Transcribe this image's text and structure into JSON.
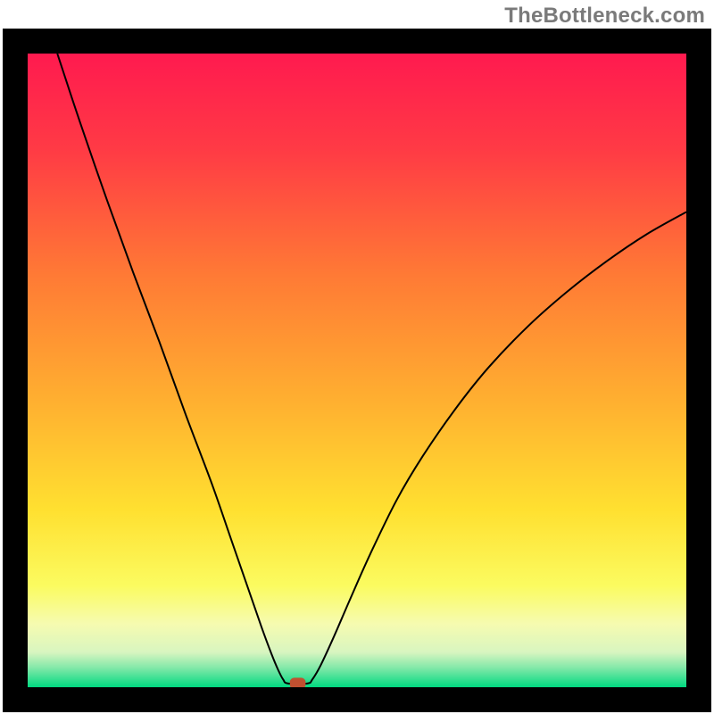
{
  "watermark": "TheBottleneck.com",
  "chart_data": {
    "type": "line",
    "title": "",
    "xlabel": "",
    "ylabel": "",
    "xlim": [
      0,
      100
    ],
    "ylim": [
      0,
      100
    ],
    "gradient_stops": [
      {
        "offset": 0.0,
        "color": "#ff1a4f"
      },
      {
        "offset": 0.15,
        "color": "#ff3a45"
      },
      {
        "offset": 0.35,
        "color": "#ff7a35"
      },
      {
        "offset": 0.55,
        "color": "#ffb030"
      },
      {
        "offset": 0.72,
        "color": "#ffe030"
      },
      {
        "offset": 0.84,
        "color": "#fbfb60"
      },
      {
        "offset": 0.9,
        "color": "#f6fbb0"
      },
      {
        "offset": 0.945,
        "color": "#d8f5c0"
      },
      {
        "offset": 0.97,
        "color": "#80e8a8"
      },
      {
        "offset": 1.0,
        "color": "#00d980"
      }
    ],
    "series": [
      {
        "name": "bottleneck-curve",
        "color": "#000000",
        "stroke_width": 2,
        "x": [
          4.5,
          8,
          12,
          16,
          20,
          24,
          28,
          31,
          33.5,
          35.5,
          37,
          38,
          38.8,
          39.5,
          42.5,
          43.2,
          44.5,
          46.5,
          49,
          52,
          56,
          60,
          65,
          70,
          76,
          82,
          88,
          94,
          100
        ],
        "y": [
          100,
          89,
          77,
          65.5,
          54.5,
          43,
          32,
          23,
          15.5,
          9.5,
          5.3,
          2.8,
          1.2,
          0.6,
          0.6,
          1.2,
          3.5,
          8,
          14,
          21,
          29.5,
          36.5,
          44,
          50.5,
          57,
          62.5,
          67.3,
          71.5,
          75.0
        ]
      }
    ],
    "marker": {
      "x": 41.0,
      "y": 0.6,
      "width": 2.4,
      "height": 1.8,
      "color": "#c05030"
    },
    "plot_frame": {
      "stroke": "#000000",
      "stroke_width": 28
    }
  }
}
